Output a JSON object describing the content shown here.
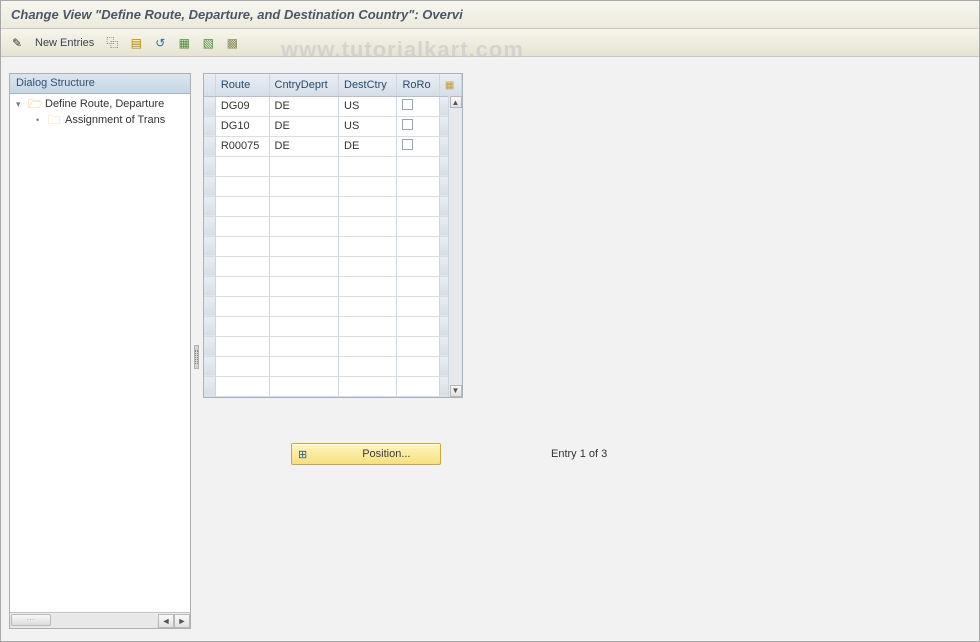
{
  "title": "Change View \"Define Route, Departure, and Destination Country\": Overvi",
  "watermark": "www.tutorialkart.com",
  "toolbar": {
    "new_entries_label": "New Entries",
    "icons": [
      {
        "name": "change-icon",
        "glyph": "✎"
      },
      {
        "name": "copy-icon",
        "glyph": "⿻"
      },
      {
        "name": "save-icon",
        "glyph": "▤"
      },
      {
        "name": "undo-icon",
        "glyph": "↺"
      },
      {
        "name": "select-all-icon",
        "glyph": "▦"
      },
      {
        "name": "select-block-icon",
        "glyph": "▧"
      },
      {
        "name": "deselect-icon",
        "glyph": "▩"
      }
    ]
  },
  "tree": {
    "header": "Dialog Structure",
    "root": {
      "label": "Define Route, Departure",
      "state": "open"
    },
    "child": {
      "label": "Assignment of Trans",
      "state": "closed"
    }
  },
  "grid": {
    "columns": [
      "Route",
      "CntryDeprt",
      "DestCtry",
      "RoRo"
    ],
    "rows": [
      {
        "route": "DG09",
        "dep": "DE",
        "dest": "US",
        "roro": false
      },
      {
        "route": "DG10",
        "dep": "DE",
        "dest": "US",
        "roro": false
      },
      {
        "route": "R00075",
        "dep": "DE",
        "dest": "DE",
        "roro": false
      }
    ],
    "blank_rows": 12
  },
  "footer": {
    "position_label": "Position...",
    "entry_text": "Entry 1 of 3"
  }
}
